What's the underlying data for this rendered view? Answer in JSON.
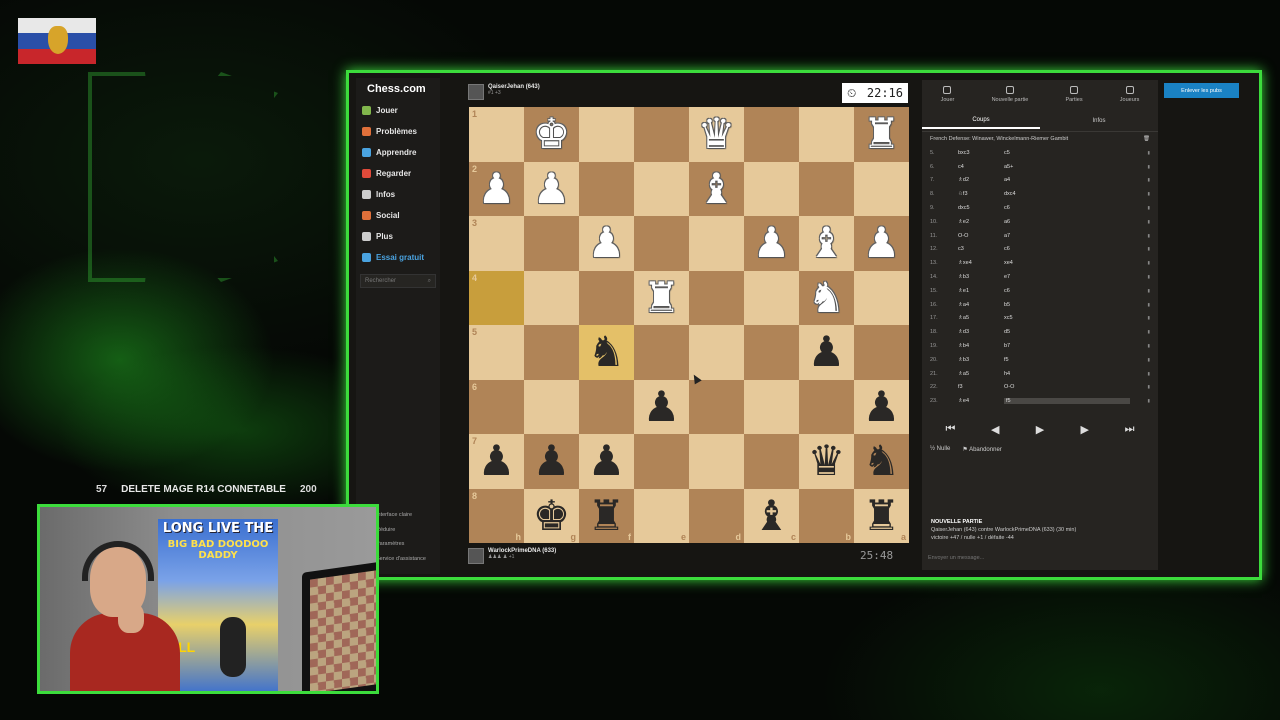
{
  "ticker": {
    "count": "57",
    "text": "DELETE MAGE R14 CONNETABLE",
    "amount": "200"
  },
  "sidebar": {
    "logo": "Chess.com",
    "items": [
      {
        "label": "Jouer",
        "icon": "play-icon",
        "color": "#81b64c"
      },
      {
        "label": "Problèmes",
        "icon": "puzzle-icon",
        "color": "#e0703a"
      },
      {
        "label": "Apprendre",
        "icon": "learn-icon",
        "color": "#4aa3e0"
      },
      {
        "label": "Regarder",
        "icon": "watch-icon",
        "color": "#e04a3a"
      },
      {
        "label": "Infos",
        "icon": "news-icon",
        "color": "#cccccc"
      },
      {
        "label": "Social",
        "icon": "social-icon",
        "color": "#e0703a"
      },
      {
        "label": "Plus",
        "icon": "more-icon",
        "color": "#cccccc"
      },
      {
        "label": "Essai gratuit",
        "icon": "diamond-icon",
        "color": "#4aa3e0"
      }
    ],
    "search_placeholder": "Rechercher",
    "bottom": [
      "Interface claire",
      "Réduire",
      "Paramètres",
      "Service d'assistance"
    ]
  },
  "top_player": {
    "name": "QaiserJehan (643)",
    "sub": "#1 +3",
    "clock": "22:16"
  },
  "bottom_player": {
    "name": "WarlockPrimeDNA (633)",
    "sub": "♟♟♟ ♟ +1",
    "clock": "25:48"
  },
  "board": {
    "ranks": [
      "1",
      "2",
      "3",
      "4",
      "5",
      "6",
      "7",
      "8"
    ],
    "files": [
      "h",
      "g",
      "f",
      "e",
      "d",
      "c",
      "b",
      "a"
    ],
    "rows": [
      [
        "",
        "wK",
        "",
        "",
        "wQ",
        "",
        "",
        "wR"
      ],
      [
        "wP",
        "wP",
        "",
        "",
        "wB",
        "",
        "",
        ""
      ],
      [
        "",
        "",
        "wP",
        "",
        "",
        "wP",
        "wB",
        "wP"
      ],
      [
        "",
        "",
        "",
        "wR",
        "",
        "",
        "wN",
        ""
      ],
      [
        "",
        "",
        "bN",
        "",
        "",
        "",
        "bP",
        ""
      ],
      [
        "",
        "",
        "",
        "bP",
        "",
        "",
        "",
        "bP"
      ],
      [
        "bP",
        "bP",
        "bP",
        "",
        "",
        "",
        "bQ",
        "bN"
      ],
      [
        "",
        "bK",
        "bR",
        "",
        "",
        "bB",
        "",
        "bR"
      ]
    ]
  },
  "right_panel": {
    "upload_button": "Enlever les pubs",
    "top_tabs": [
      "Jouer",
      "Nouvelle partie",
      "Parties",
      "Joueurs"
    ],
    "sub_tabs": [
      "Coups",
      "Infos"
    ],
    "opening": "French Defense: Winawer, Winckelmann-Riemer Gambit",
    "moves": [
      {
        "n": "5.",
        "w": "bxc3",
        "b": "c5"
      },
      {
        "n": "6.",
        "w": "c4",
        "b": "a5+"
      },
      {
        "n": "7.",
        "w": "♗d2",
        "b": "a4"
      },
      {
        "n": "8.",
        "w": "♘f3",
        "b": "dxc4"
      },
      {
        "n": "9.",
        "w": "dxc5",
        "b": "c6"
      },
      {
        "n": "10.",
        "w": "♗e2",
        "b": "a6"
      },
      {
        "n": "11.",
        "w": "O-O",
        "b": "a7"
      },
      {
        "n": "12.",
        "w": "c3",
        "b": "c6"
      },
      {
        "n": "13.",
        "w": "♗xe4",
        "b": "xe4"
      },
      {
        "n": "14.",
        "w": "♗b3",
        "b": "e7"
      },
      {
        "n": "15.",
        "w": "♗e1",
        "b": "c6"
      },
      {
        "n": "16.",
        "w": "♗a4",
        "b": "b5"
      },
      {
        "n": "17.",
        "w": "♗a5",
        "b": "xc5"
      },
      {
        "n": "18.",
        "w": "♗d3",
        "b": "d5"
      },
      {
        "n": "19.",
        "w": "♗b4",
        "b": "b7"
      },
      {
        "n": "20.",
        "w": "♗b3",
        "b": "f5"
      },
      {
        "n": "21.",
        "w": "♗a5",
        "b": "h4"
      },
      {
        "n": "22.",
        "w": "f3",
        "b": "O-O"
      },
      {
        "n": "23.",
        "w": "♗e4",
        "b": "f5"
      }
    ],
    "draw": "Nulle",
    "resign": "Abandonner",
    "new_game_title": "NOUVELLE PARTIE",
    "new_game_line1": "QaiserJehan (643) contre WarlockPrimeDNA (633) (30 min)",
    "new_game_line2": "victoire +47 / nulle +1 / défaite -44",
    "chat_placeholder": "Envoyer un message..."
  },
  "webcam": {
    "poster_title": "LONG LIVE THE",
    "poster_sub": "BIG BAD DOODOO DADDY",
    "poster_all": "ALL"
  }
}
